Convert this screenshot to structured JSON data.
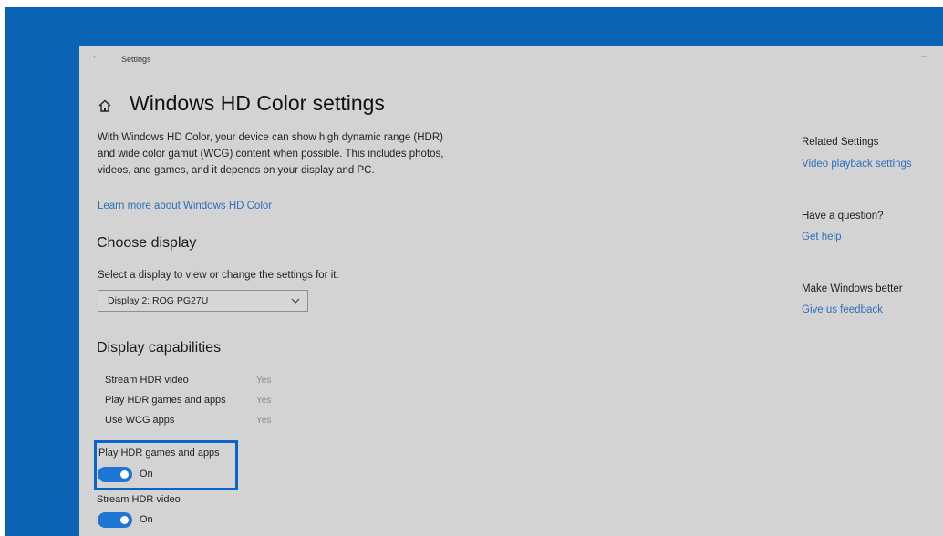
{
  "window": {
    "title": "Settings",
    "back_glyph": "←",
    "minimize_glyph": "–"
  },
  "page": {
    "title": "Windows HD Color settings",
    "description": "With Windows HD Color, your device can show high dynamic range (HDR) and wide color gamut (WCG) content when possible. This includes photos, videos, and games, and it depends on your display and PC.",
    "learn_more": "Learn more about Windows HD Color"
  },
  "choose_display": {
    "heading": "Choose display",
    "select_label": "Select a display to view or change the settings for it.",
    "selected": "Display 2: ROG PG27U"
  },
  "capabilities": {
    "heading": "Display capabilities",
    "rows": [
      {
        "label": "Stream HDR video",
        "value": "Yes"
      },
      {
        "label": "Play HDR games and apps",
        "value": "Yes"
      },
      {
        "label": "Use WCG apps",
        "value": "Yes"
      }
    ]
  },
  "toggles": [
    {
      "label": "Play HDR games and apps",
      "state": "On",
      "on": true
    },
    {
      "label": "Stream HDR video",
      "state": "On",
      "on": true
    }
  ],
  "related": {
    "heading": "Related Settings",
    "link": "Video playback settings",
    "question_heading": "Have a question?",
    "help_link": "Get help",
    "better_heading": "Make Windows better",
    "feedback_link": "Give us feedback"
  },
  "colors": {
    "desktop": "#0a63b4",
    "window_bg": "#d3d3d3",
    "accent": "#1e76d4",
    "link": "#2e6fb8",
    "highlight_border": "#0a63c8"
  }
}
